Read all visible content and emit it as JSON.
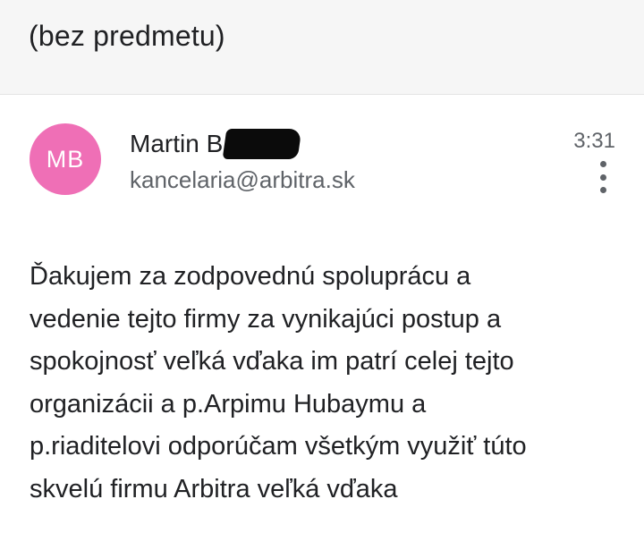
{
  "header": {
    "subject": "(bez predmetu)"
  },
  "message": {
    "avatar_initials": "MB",
    "avatar_color": "#ef6fb6",
    "sender_name": "Martin B",
    "sender_email": "kancelaria@arbitra.sk",
    "time": "3:31",
    "more_icon": "more-vert-icon",
    "body_lines": [
      "Ďakujem za zodpovednú spoluprácu a",
      "vedenie tejto firmy za vynikajúci postup a",
      "spokojnosť veľká vďaka im patrí celej tejto",
      "organizácii a p.Arpimu Hubaymu a",
      "p.riaditelovi odporúčam všetkým využiť túto",
      "skvelú firmu Arbitra veľká vďaka"
    ]
  }
}
